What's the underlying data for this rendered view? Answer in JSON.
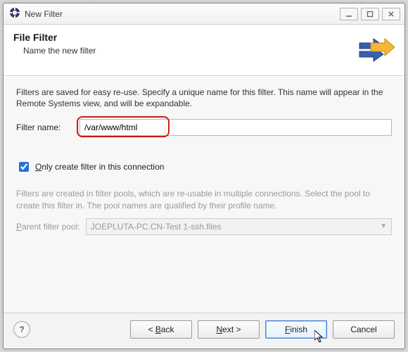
{
  "window": {
    "title": "New Filter"
  },
  "banner": {
    "heading": "File Filter",
    "subtitle": "Name the new filter"
  },
  "content": {
    "intro": "Filters are saved for easy re-use. Specify a unique name for this filter. This name will appear in the Remote Systems view, and will be expandable.",
    "filter_name_label": "Filter name:",
    "filter_name_value": "/var/www/html",
    "only_this_connection_checked": true,
    "only_this_connection_prefix": "O",
    "only_this_connection_rest": "nly create filter in this connection",
    "pool_desc": "Filters are created in filter pools, which are re-usable in multiple connections. Select the pool to create this filter in. The pool names are qualified by their profile name.",
    "parent_pool_prefix": "P",
    "parent_pool_rest": "arent filter pool:",
    "parent_pool_value": "JOEPLUTA-PC.CN-Test 1-ssh.files"
  },
  "buttons": {
    "back_prefix": "< ",
    "back_u": "B",
    "back_rest": "ack",
    "next_u": "N",
    "next_rest": "ext >",
    "finish_u": "F",
    "finish_rest": "inish",
    "cancel": "Cancel",
    "help": "?"
  }
}
